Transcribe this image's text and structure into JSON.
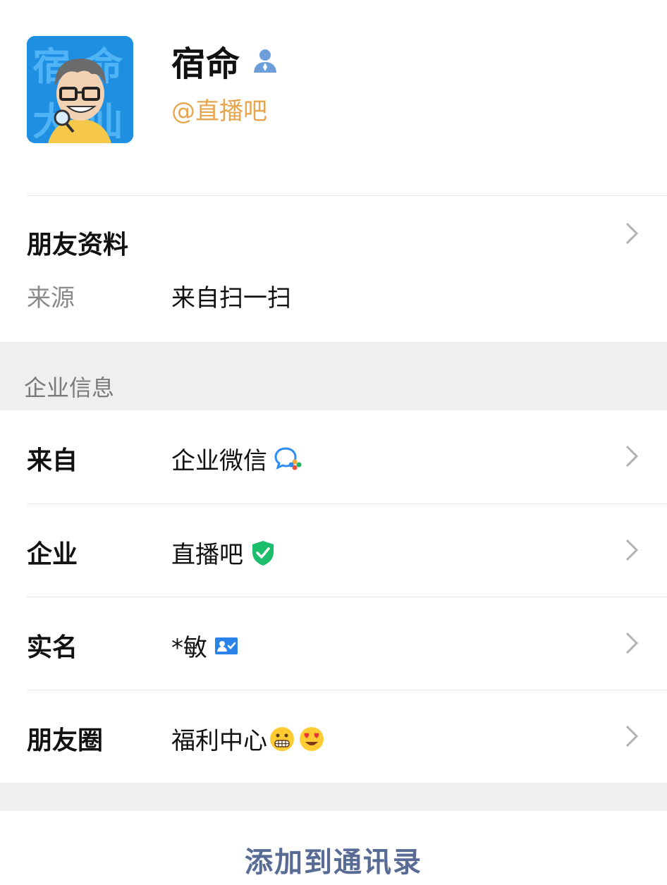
{
  "profile": {
    "name": "宿命",
    "handle": "@直播吧",
    "avatar_text": "宿命 大仙",
    "name_icon": "person-icon"
  },
  "friend_info": {
    "title": "朋友资料",
    "source_label": "来源",
    "source_value": "来自扫一扫"
  },
  "section_header": "企业信息",
  "rows": [
    {
      "label": "来自",
      "value": "企业微信",
      "icon": "wecom-icon"
    },
    {
      "label": "企业",
      "value": "直播吧",
      "icon": "verified-shield-icon"
    },
    {
      "label": "实名",
      "value": "*敏",
      "icon": "id-card-icon"
    },
    {
      "label": "朋友圈",
      "value": "福利中心",
      "icon": "emoji-grimace-icon emoji-heart-eyes-icon"
    }
  ],
  "action": {
    "add_contact": "添加到通讯录"
  },
  "colors": {
    "accent_link": "#576b95",
    "handle": "#e7a54d",
    "verified_green": "#1bbe6b",
    "section_gray": "#efefef"
  }
}
